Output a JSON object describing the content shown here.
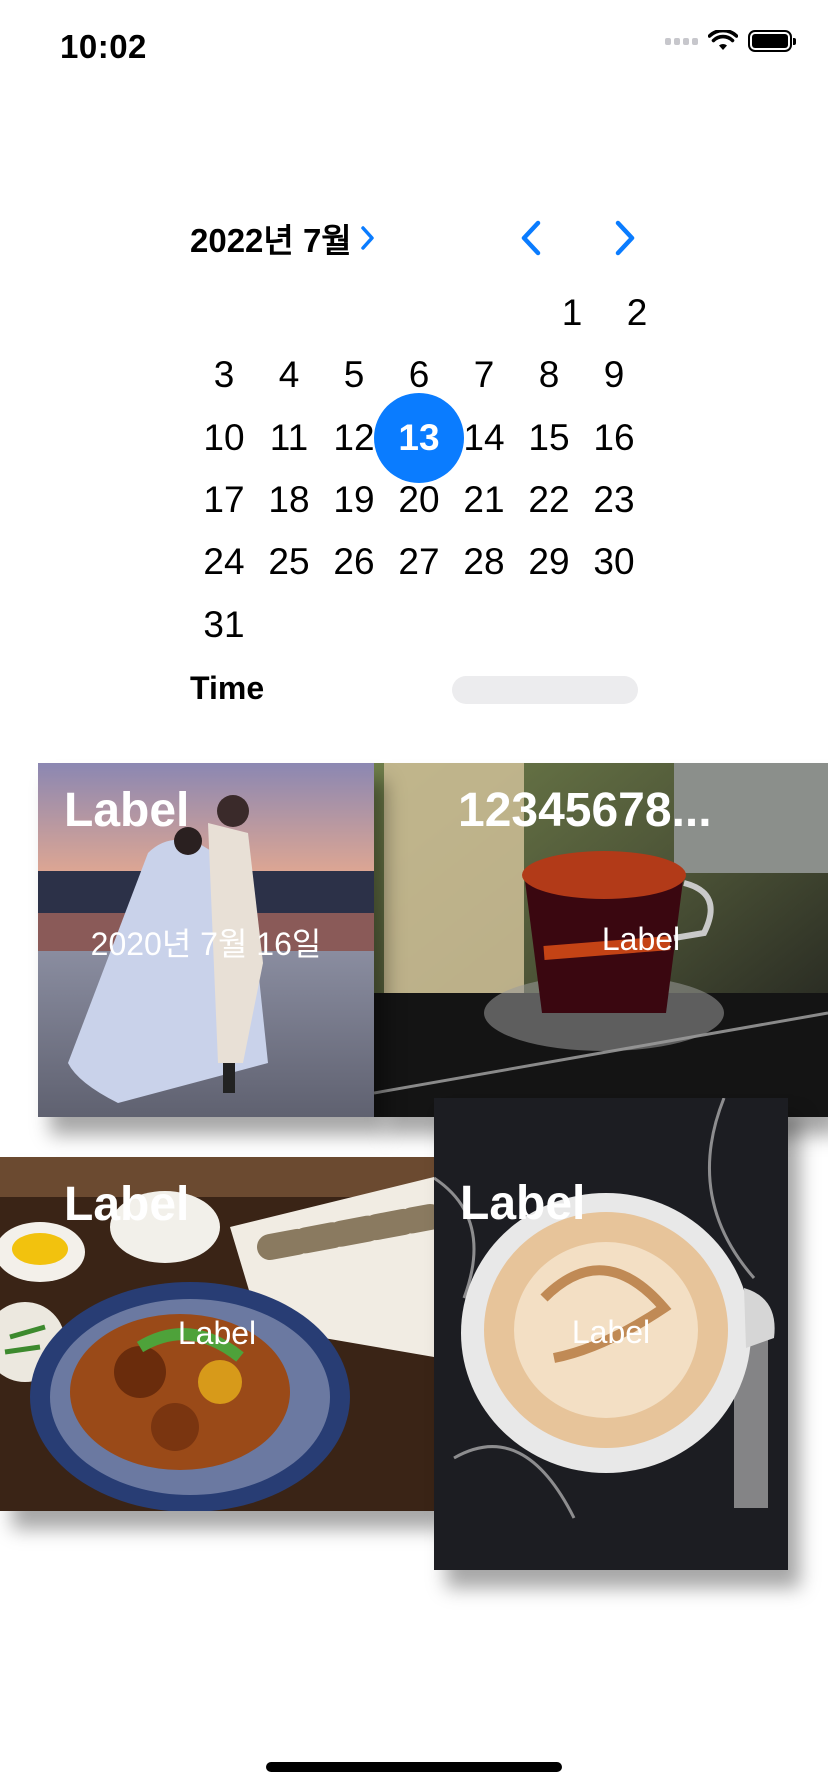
{
  "status_bar": {
    "time": "10:02"
  },
  "date_picker": {
    "month_label": "2022년 7월",
    "selected_day": 13,
    "days": [
      "1",
      "2",
      "3",
      "4",
      "5",
      "6",
      "7",
      "8",
      "9",
      "10",
      "11",
      "12",
      "13",
      "14",
      "15",
      "16",
      "17",
      "18",
      "19",
      "20",
      "21",
      "22",
      "23",
      "24",
      "25",
      "26",
      "27",
      "28",
      "29",
      "30",
      "31"
    ],
    "time_label": "Time",
    "accent_color": "#0a7cff"
  },
  "cards": [
    {
      "title": "Label",
      "subtitle": "2020년 7월 16일"
    },
    {
      "title": "12345678...",
      "subtitle": "Label"
    },
    {
      "title": "Label",
      "subtitle": "Label"
    },
    {
      "title": "Label",
      "subtitle": "Label"
    }
  ]
}
